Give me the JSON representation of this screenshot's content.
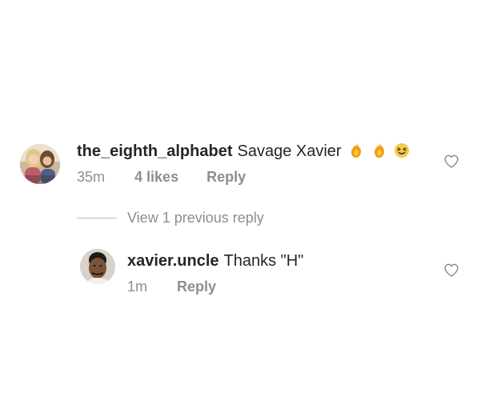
{
  "comment": {
    "username": "the_eighth_alphabet",
    "text": "Savage Xavier",
    "time": "35m",
    "likes": "4 likes",
    "reply_label": "Reply",
    "reactions": [
      "fire-emoji",
      "fire-emoji",
      "laughing-emoji"
    ]
  },
  "view_replies": "View 1 previous reply",
  "reply": {
    "username": "xavier.uncle",
    "text": "Thanks \"H\"",
    "time": "1m",
    "reply_label": "Reply"
  },
  "colors": {
    "text": "#262626",
    "meta": "#8e8e8e",
    "divider": "#bdbdbd",
    "heart": "#8e8e8e"
  },
  "icons": {
    "like": "heart-outline-icon",
    "avatar_main": "user-avatar",
    "avatar_reply": "user-avatar"
  }
}
